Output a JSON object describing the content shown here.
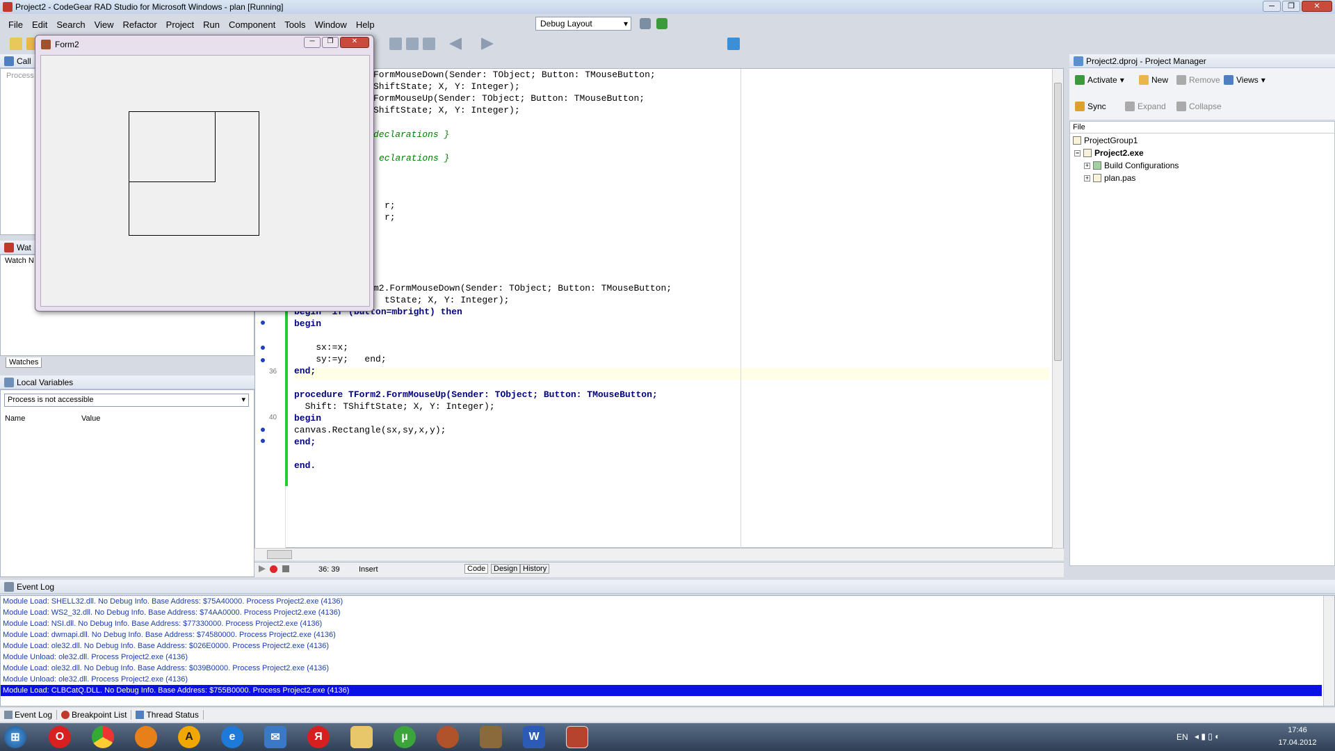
{
  "window": {
    "title": "Project2 - CodeGear RAD Studio for Microsoft Windows - plan [Running]"
  },
  "menu": [
    "File",
    "Edit",
    "Search",
    "View",
    "Refactor",
    "Project",
    "Run",
    "Component",
    "Tools",
    "Window",
    "Help"
  ],
  "layout_combo": "Debug Layout",
  "left_panels": {
    "call_stack": "Call",
    "call_stack_placeholder": "Process",
    "watches_head": "Wat",
    "watch_col": "Watch N",
    "watches_tab": "Watches",
    "local_vars": "Local Variables",
    "local_combo": "Process is not accessible",
    "col_name": "Name",
    "col_value": "Value"
  },
  "form2": {
    "title": "Form2"
  },
  "code_lines": [
    {
      "text": "FormMouseDown(Sender: TObject; Button: TMouseButton;",
      "type": "plain"
    },
    {
      "text": "ShiftState; X, Y: Integer);",
      "type": "plain"
    },
    {
      "text": "FormMouseUp(Sender: TObject; Button: TMouseButton;",
      "type": "plain"
    },
    {
      "text": "ShiftState; X, Y: Integer);",
      "type": "plain"
    },
    {
      "text": "declarations }",
      "type": "comment"
    },
    {
      "text": "eclarations }",
      "type": "comment"
    },
    {
      "text": "r;",
      "type": "plain"
    },
    {
      "text": "r;",
      "type": "plain"
    },
    {
      "text": "m2.FormMouseDown(Sender: TObject; Button: TMouseButton;",
      "type": "plain"
    },
    {
      "text": "tState; X, Y: Integer);",
      "type": "plain"
    },
    {
      "text": "begin  if (button=mbright) then",
      "type": "kwline"
    },
    {
      "text": "begin",
      "type": "kw"
    },
    {
      "text": "    sx:=x;",
      "type": "plain"
    },
    {
      "text": "    sy:=y;   end;",
      "type": "plain"
    },
    {
      "text": "end;",
      "type": "kw"
    },
    {
      "text": "procedure TForm2.FormMouseUp(Sender: TObject; Button: TMouseButton;",
      "type": "kwline"
    },
    {
      "text": "  Shift: TShiftState; X, Y: Integer);",
      "type": "plain"
    },
    {
      "text": "begin",
      "type": "kw"
    },
    {
      "text": "canvas.Rectangle(sx,sy,x,y);",
      "type": "plain"
    },
    {
      "text": "end;",
      "type": "kw"
    },
    {
      "text": "end.",
      "type": "kw"
    }
  ],
  "line_numbers": {
    "a": "36",
    "b": "40"
  },
  "editor_status": {
    "pos": "36: 39",
    "mode": "Insert",
    "tabs": [
      "Code",
      "Design",
      "History"
    ]
  },
  "project_manager": {
    "title": "Project2.dproj - Project Manager",
    "buttons": {
      "activate": "Activate",
      "new": "New",
      "remove": "Remove",
      "views": "Views",
      "sync": "Sync",
      "expand": "Expand",
      "collapse": "Collapse"
    },
    "col_file": "File",
    "tree": [
      "ProjectGroup1",
      "Project2.exe",
      "Build Configurations",
      "plan.pas"
    ]
  },
  "event_log": {
    "title": "Event Log",
    "lines": [
      "Module Load: SHELL32.dll. No Debug Info. Base Address: $75A40000. Process Project2.exe (4136)",
      "Module Load: WS2_32.dll. No Debug Info. Base Address: $74AA0000. Process Project2.exe (4136)",
      "Module Load: NSI.dll. No Debug Info. Base Address: $77330000. Process Project2.exe (4136)",
      "Module Load: dwmapi.dll. No Debug Info. Base Address: $74580000. Process Project2.exe (4136)",
      "Module Load: ole32.dll. No Debug Info. Base Address: $026E0000. Process Project2.exe (4136)",
      "Module Unload: ole32.dll. Process Project2.exe (4136)",
      "Module Load: ole32.dll. No Debug Info. Base Address: $039B0000. Process Project2.exe (4136)",
      "Module Unload: ole32.dll. Process Project2.exe (4136)",
      "Module Load: CLBCatQ.DLL. No Debug Info. Base Address: $755B0000. Process Project2.exe (4136)"
    ],
    "tabs": [
      "Event Log",
      "Breakpoint List",
      "Thread Status"
    ]
  },
  "taskbar": {
    "lang": "EN",
    "time": "17:46",
    "date": "17.04.2012"
  },
  "colors": {
    "accent": "#0a10e6",
    "changebar": "#22cc33",
    "keyword": "#000080"
  }
}
